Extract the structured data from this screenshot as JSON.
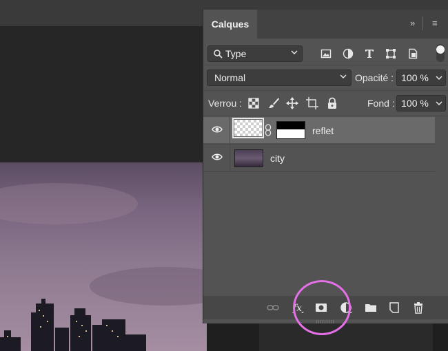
{
  "panel": {
    "tab_title": "Calques",
    "collapse_glyph": "»",
    "menu_glyph": "≡"
  },
  "filter": {
    "label": "Type",
    "icons": [
      "image-filter-icon",
      "adjustment-filter-icon",
      "text-filter-icon",
      "shape-filter-icon",
      "smart-object-filter-icon"
    ]
  },
  "blend": {
    "mode": "Normal",
    "opacity_label": "Opacité :",
    "opacity_value": "100 %"
  },
  "lock": {
    "label": "Verrou :",
    "fill_label": "Fond :",
    "fill_value": "100 %"
  },
  "layers": [
    {
      "name": "reflet",
      "selected": true,
      "has_mask": true
    },
    {
      "name": "city",
      "selected": false,
      "has_mask": false
    }
  ],
  "colors": {
    "panel_bg": "#535353",
    "selected_row": "#6a6a6a",
    "annotation": "#e46fe6"
  }
}
